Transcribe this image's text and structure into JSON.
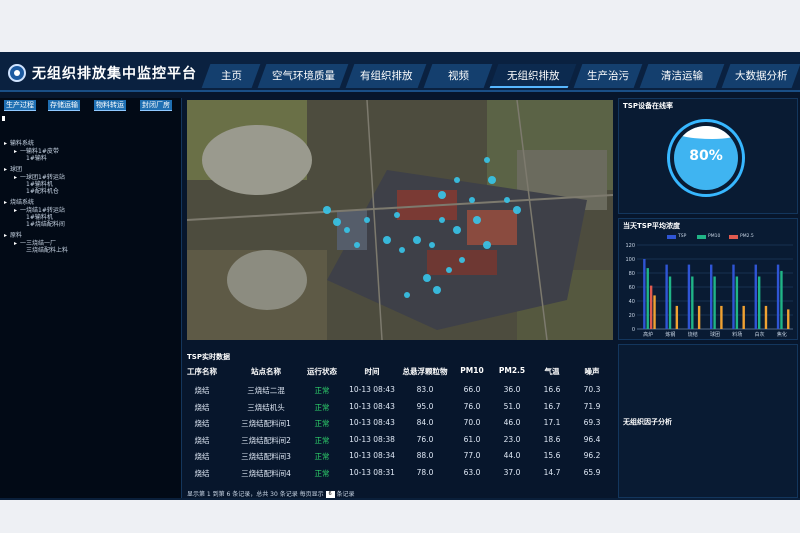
{
  "header": {
    "title": "无组织排放集中监控平台",
    "nav": [
      "主页",
      "空气环境质量",
      "有组织排放",
      "视频",
      "无组织排放",
      "生产治污",
      "清洁运输",
      "大数据分析"
    ],
    "active_nav": "无组织排放"
  },
  "sidebar": {
    "tabs": [
      "生产过程",
      "存储运输",
      "物料转运",
      "封闭厂房"
    ],
    "tree": [
      "输料系统",
      "一输料1#皮带",
      "1#输料",
      "球团",
      "一球团1#转运站",
      "1#输料机",
      "1#配料机仓",
      "烧结系统",
      "一烧结1#转运站",
      "1#输料机",
      "1#烧结配料间",
      "原料",
      "一三烧结一厂",
      "三烧结配料上料"
    ]
  },
  "table": {
    "title": "TSP实时数据",
    "columns": [
      "工序名称",
      "站点名称",
      "运行状态",
      "时间",
      "总悬浮颗粒物",
      "PM10",
      "PM2.5",
      "气温",
      "噪声"
    ],
    "rows": [
      [
        "烧结",
        "三烧结二混",
        "正常",
        "10-13 08:43",
        "83.0",
        "66.0",
        "36.0",
        "16.6",
        "70.3"
      ],
      [
        "烧结",
        "三烧结机头",
        "正常",
        "10-13 08:43",
        "95.0",
        "76.0",
        "51.0",
        "16.7",
        "71.9"
      ],
      [
        "烧结",
        "三烧结配料间1",
        "正常",
        "10-13 08:43",
        "84.0",
        "70.0",
        "46.0",
        "17.1",
        "69.3"
      ],
      [
        "烧结",
        "三烧结配料间2",
        "正常",
        "10-13 08:38",
        "76.0",
        "61.0",
        "23.0",
        "18.6",
        "96.4"
      ],
      [
        "烧结",
        "三烧结配料间3",
        "正常",
        "10-13 08:34",
        "88.0",
        "77.0",
        "44.0",
        "15.6",
        "96.2"
      ],
      [
        "烧结",
        "三烧结配料间4",
        "正常",
        "10-13 08:31",
        "78.0",
        "63.0",
        "37.0",
        "14.7",
        "65.9"
      ]
    ],
    "pager_prefix": "显示第 1 到第 6 条记录，总共 30 条记录 每页显示",
    "page_size": "6",
    "pager_suffix": "条记录"
  },
  "right": {
    "online_title": "TSP设备在线率",
    "online_value": "80%",
    "online_fraction": 0.8,
    "chart_panel_title": "当天TSP平均浓度",
    "analysis_title": "无组织因子分析"
  },
  "colors": {
    "tsp": "#2f55d4",
    "pm10": "#20b486",
    "pm25": "#e05a4f",
    "extra": "#f0a232"
  },
  "chart_data": {
    "type": "bar",
    "ylim": [
      0,
      120
    ],
    "yticks": [
      0,
      20,
      40,
      60,
      80,
      100,
      120
    ],
    "categories": [
      "高炉",
      "炼钢",
      "烧结",
      "球团",
      "料场",
      "白灰",
      "焦化"
    ],
    "legend": [
      "TSP",
      "PM10",
      "PM2.5"
    ],
    "series": [
      {
        "name": "TSP",
        "values": [
          100,
          92,
          92,
          92,
          92,
          92,
          92
        ]
      },
      {
        "name": "PM10",
        "values": [
          87,
          75,
          75,
          75,
          75,
          75,
          83
        ]
      },
      {
        "name": "PM2.5",
        "values": [
          62,
          0,
          0,
          0,
          0,
          0,
          0
        ]
      },
      {
        "values": [
          48,
          33,
          33,
          33,
          33,
          33,
          28
        ]
      }
    ]
  }
}
